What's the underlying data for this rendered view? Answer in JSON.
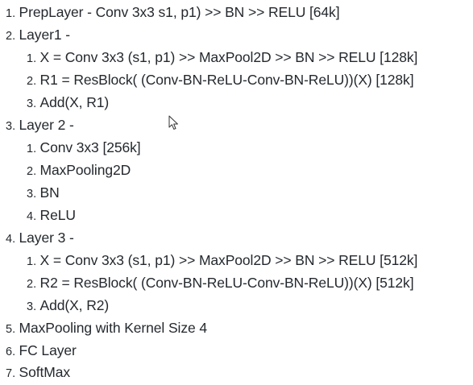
{
  "outline": [
    {
      "num": "1.",
      "text": "PrepLayer - Conv 3x3 s1, p1) >> BN >> RELU [64k]"
    },
    {
      "num": "2.",
      "text": "Layer1 -",
      "children": [
        {
          "num": "1.",
          "text": "X = Conv 3x3 (s1, p1) >> MaxPool2D >> BN >> RELU [128k]"
        },
        {
          "num": "2.",
          "text": "R1 = ResBlock( (Conv-BN-ReLU-Conv-BN-ReLU))(X) [128k]"
        },
        {
          "num": "3.",
          "text": "Add(X, R1)"
        }
      ]
    },
    {
      "num": "3.",
      "text": "Layer 2 -",
      "children": [
        {
          "num": "1.",
          "text": "Conv 3x3 [256k]"
        },
        {
          "num": "2.",
          "text": "MaxPooling2D"
        },
        {
          "num": "3.",
          "text": "BN"
        },
        {
          "num": "4.",
          "text": "ReLU"
        }
      ]
    },
    {
      "num": "4.",
      "text": "Layer 3 -",
      "children": [
        {
          "num": "1.",
          "text": "X = Conv 3x3 (s1, p1) >> MaxPool2D >> BN >> RELU [512k]"
        },
        {
          "num": "2.",
          "text": "R2 = ResBlock( (Conv-BN-ReLU-Conv-BN-ReLU))(X) [512k]"
        },
        {
          "num": "3.",
          "text": "Add(X, R2)"
        }
      ]
    },
    {
      "num": "5.",
      "text": "MaxPooling with Kernel Size 4"
    },
    {
      "num": "6.",
      "text": "FC Layer"
    },
    {
      "num": "7.",
      "text": "SoftMax"
    }
  ],
  "colors": {
    "text": "#24292e",
    "background": "#ffffff"
  },
  "icons": {
    "cursor": "mouse-pointer-icon"
  }
}
